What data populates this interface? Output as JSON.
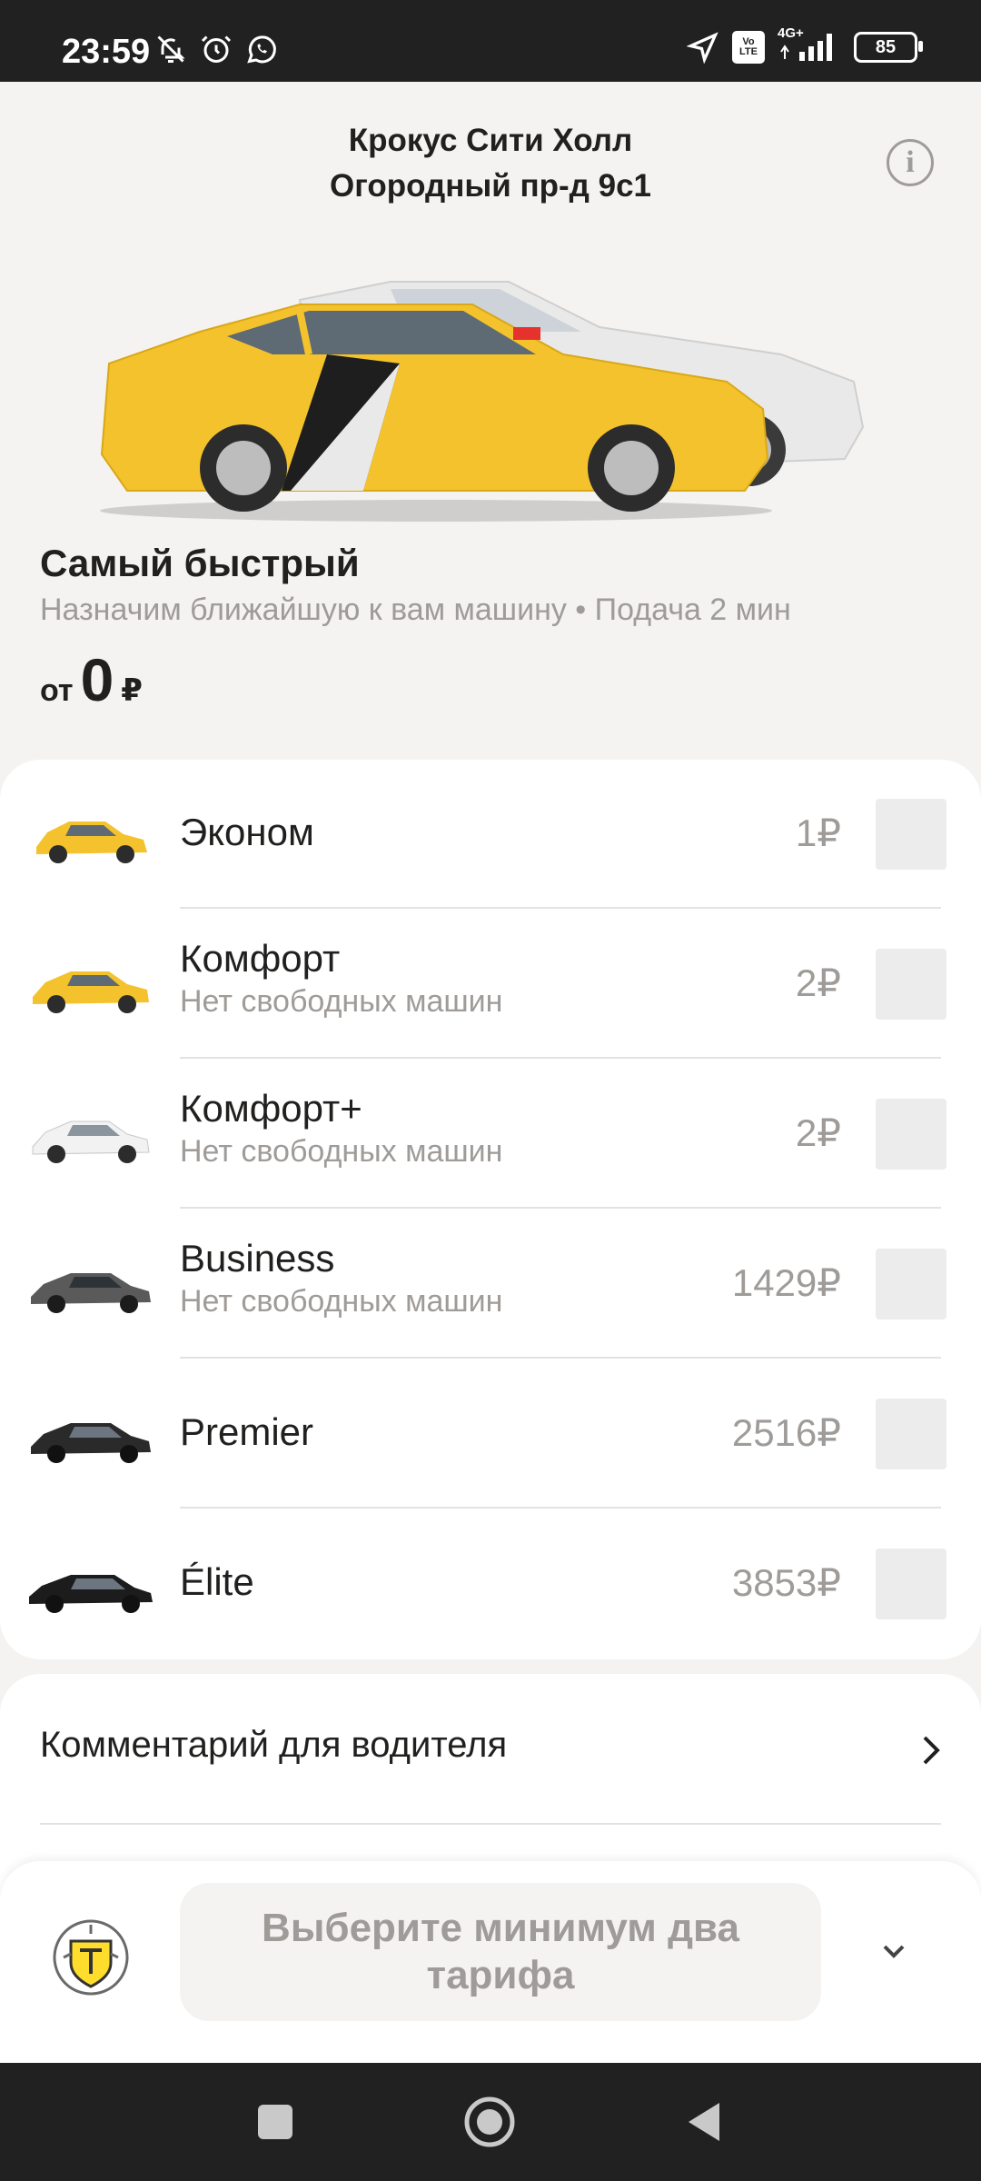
{
  "status_bar": {
    "time": "23:59",
    "left_icons": [
      "bell-off-icon",
      "alarm-icon",
      "whatsapp-icon"
    ],
    "right_icons": [
      "location-arrow-icon",
      "volte-icon",
      "signal-icon",
      "battery-icon"
    ],
    "volte_label": "Vo LTE",
    "network_label": "4G+",
    "battery_level": "85"
  },
  "header": {
    "address_line1": "Крокус Сити Холл",
    "address_line2": "Огородный пр-д 9с1",
    "info_glyph": "i"
  },
  "hero": {
    "title": "Самый быстрый",
    "subtitle": "Назначим ближайшую к вам машину • Подача 2 мин",
    "price_prefix": "от",
    "price_value": "0",
    "currency": "₽"
  },
  "tariffs": [
    {
      "name": "Эконом",
      "note": "",
      "price": "1₽",
      "car_color": "#f4c22c",
      "checked": false
    },
    {
      "name": "Комфорт",
      "note": "Нет свободных машин",
      "price": "2₽",
      "car_color": "#f4c22c",
      "checked": false
    },
    {
      "name": "Комфорт+",
      "note": "Нет свободных машин",
      "price": "2₽",
      "car_color": "#f0f0f0",
      "checked": false
    },
    {
      "name": "Business",
      "note": "Нет свободных машин",
      "price": "1429₽",
      "car_color": "#5a5a5a",
      "checked": false
    },
    {
      "name": "Premier",
      "note": "",
      "price": "2516₽",
      "car_color": "#2a2a2a",
      "checked": false
    },
    {
      "name": "Élite",
      "note": "",
      "price": "3853₽",
      "car_color": "#1c1c1c",
      "checked": false
    }
  ],
  "comment": {
    "label": "Комментарий для водителя"
  },
  "bottom": {
    "cta_label": "Выберите минимум два тарифа",
    "logo": "tinkoff-logo"
  },
  "colors": {
    "background": "#f4f3f1",
    "card": "#ffffff",
    "muted_text": "#9e9b98",
    "taxi_yellow": "#f4c22c"
  }
}
